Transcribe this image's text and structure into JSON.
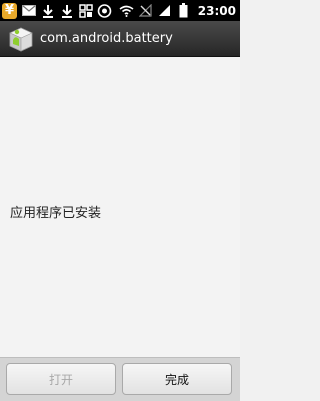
{
  "status_bar": {
    "time": "23:00",
    "left_icons": [
      "yen-app-icon",
      "gmail-icon",
      "download-icon",
      "download-icon",
      "apps-icon",
      "chat-icon"
    ],
    "right_icons": [
      "wifi-icon",
      "signal-off-icon",
      "signal-icon",
      "battery-icon"
    ]
  },
  "title_bar": {
    "title": "com.android.battery"
  },
  "content": {
    "message": "应用程序已安装"
  },
  "buttons": {
    "open_label": "打开",
    "done_label": "完成"
  },
  "colors": {
    "status_bar_bg": "#000000",
    "title_bar_bg": "#333333",
    "content_bg": "#f3f3f3",
    "button_bar_bg": "#d4d4d4"
  }
}
